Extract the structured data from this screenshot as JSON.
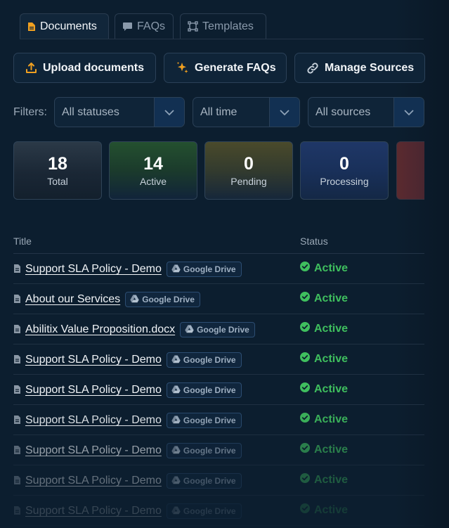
{
  "tabs": [
    {
      "label": "Documents",
      "icon": "document-icon",
      "active": true
    },
    {
      "label": "FAQs",
      "icon": "chat-bubble-icon",
      "active": false
    },
    {
      "label": "Templates",
      "icon": "template-frame-icon",
      "active": false
    }
  ],
  "actions": {
    "upload_label": "Upload documents",
    "generate_label": "Generate FAQs",
    "manage_label": "Manage Sources"
  },
  "filters": {
    "label": "Filters:",
    "status_value": "All statuses",
    "time_value": "All time",
    "source_value": "All sources"
  },
  "stats": [
    {
      "value": "18",
      "label": "Total"
    },
    {
      "value": "14",
      "label": "Active"
    },
    {
      "value": "0",
      "label": "Pending"
    },
    {
      "value": "0",
      "label": "Processing"
    }
  ],
  "table": {
    "headers": {
      "title": "Title",
      "status": "Status"
    },
    "rows": [
      {
        "title": "Support SLA Policy - Demo",
        "source": "Google Drive",
        "status": "Active"
      },
      {
        "title": "About our Services",
        "source": "Google Drive",
        "status": "Active"
      },
      {
        "title": "Abilitix Value Proposition.docx",
        "source": "Google Drive",
        "status": "Active"
      },
      {
        "title": "Support SLA Policy - Demo",
        "source": "Google Drive",
        "status": "Active"
      },
      {
        "title": "Support SLA Policy - Demo",
        "source": "Google Drive",
        "status": "Active"
      },
      {
        "title": "Support SLA Policy - Demo",
        "source": "Google Drive",
        "status": "Active"
      },
      {
        "title": "Support SLA Policy - Demo",
        "source": "Google Drive",
        "status": "Active"
      },
      {
        "title": "Support SLA Policy - Demo",
        "source": "Google Drive",
        "status": "Active"
      },
      {
        "title": "Support SLA Policy - Demo",
        "source": "Google Drive",
        "status": "Active"
      }
    ]
  },
  "colors": {
    "background": "#0c1e2f",
    "accent_orange": "#f0a020",
    "status_green": "#3fbf5e",
    "badge_border": "#2c4d72"
  }
}
